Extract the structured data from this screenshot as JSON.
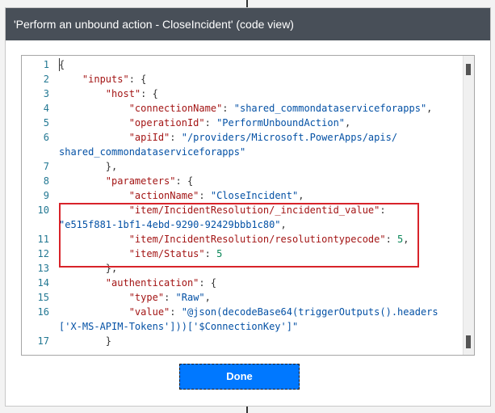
{
  "dialog": {
    "title": "'Perform an unbound action - CloseIncident' (code view)",
    "done_label": "Done"
  },
  "editor": {
    "line_numbers": [
      "1",
      "2",
      "3",
      "4",
      "5",
      "6",
      "",
      "7",
      "8",
      "9",
      "10",
      "",
      "11",
      "12",
      "13",
      "14",
      "15",
      "16",
      "",
      "17"
    ],
    "lines": [
      [
        {
          "t": "{",
          "c": "p"
        }
      ],
      [
        {
          "t": "    ",
          "c": "p"
        },
        {
          "t": "\"inputs\"",
          "c": "k"
        },
        {
          "t": ": {",
          "c": "p"
        }
      ],
      [
        {
          "t": "        ",
          "c": "p"
        },
        {
          "t": "\"host\"",
          "c": "k"
        },
        {
          "t": ": {",
          "c": "p"
        }
      ],
      [
        {
          "t": "            ",
          "c": "p"
        },
        {
          "t": "\"connectionName\"",
          "c": "k"
        },
        {
          "t": ": ",
          "c": "p"
        },
        {
          "t": "\"shared_commondataserviceforapps\"",
          "c": "s"
        },
        {
          "t": ",",
          "c": "p"
        }
      ],
      [
        {
          "t": "            ",
          "c": "p"
        },
        {
          "t": "\"operationId\"",
          "c": "k"
        },
        {
          "t": ": ",
          "c": "p"
        },
        {
          "t": "\"PerformUnboundAction\"",
          "c": "s"
        },
        {
          "t": ",",
          "c": "p"
        }
      ],
      [
        {
          "t": "            ",
          "c": "p"
        },
        {
          "t": "\"apiId\"",
          "c": "k"
        },
        {
          "t": ": ",
          "c": "p"
        },
        {
          "t": "\"/providers/Microsoft.PowerApps/apis/",
          "c": "s"
        }
      ],
      [
        {
          "t": "shared_commondataserviceforapps\"",
          "c": "s"
        }
      ],
      [
        {
          "t": "        },",
          "c": "p"
        }
      ],
      [
        {
          "t": "        ",
          "c": "p"
        },
        {
          "t": "\"parameters\"",
          "c": "k"
        },
        {
          "t": ": {",
          "c": "p"
        }
      ],
      [
        {
          "t": "            ",
          "c": "p"
        },
        {
          "t": "\"actionName\"",
          "c": "k"
        },
        {
          "t": ": ",
          "c": "p"
        },
        {
          "t": "\"CloseIncident\"",
          "c": "s"
        },
        {
          "t": ",",
          "c": "p"
        }
      ],
      [
        {
          "t": "            ",
          "c": "p"
        },
        {
          "t": "\"item/IncidentResolution/_incidentid_value\"",
          "c": "k"
        },
        {
          "t": ":",
          "c": "p"
        }
      ],
      [
        {
          "t": "\"e515f881-1bf1-4ebd-9290-92429bbb1c80\"",
          "c": "s"
        },
        {
          "t": ",",
          "c": "p"
        }
      ],
      [
        {
          "t": "            ",
          "c": "p"
        },
        {
          "t": "\"item/IncidentResolution/resolutiontypecode\"",
          "c": "k"
        },
        {
          "t": ": ",
          "c": "p"
        },
        {
          "t": "5",
          "c": "n"
        },
        {
          "t": ",",
          "c": "p"
        }
      ],
      [
        {
          "t": "            ",
          "c": "p"
        },
        {
          "t": "\"item/Status\"",
          "c": "k"
        },
        {
          "t": ": ",
          "c": "p"
        },
        {
          "t": "5",
          "c": "n"
        }
      ],
      [
        {
          "t": "        },",
          "c": "p"
        }
      ],
      [
        {
          "t": "        ",
          "c": "p"
        },
        {
          "t": "\"authentication\"",
          "c": "k"
        },
        {
          "t": ": {",
          "c": "p"
        }
      ],
      [
        {
          "t": "            ",
          "c": "p"
        },
        {
          "t": "\"type\"",
          "c": "k"
        },
        {
          "t": ": ",
          "c": "p"
        },
        {
          "t": "\"Raw\"",
          "c": "s"
        },
        {
          "t": ",",
          "c": "p"
        }
      ],
      [
        {
          "t": "            ",
          "c": "p"
        },
        {
          "t": "\"value\"",
          "c": "k"
        },
        {
          "t": ": ",
          "c": "p"
        },
        {
          "t": "\"@json(decodeBase64(triggerOutputs().headers",
          "c": "s"
        }
      ],
      [
        {
          "t": "['X-MS-APIM-Tokens']))['$ConnectionKey']\"",
          "c": "s"
        }
      ],
      [
        {
          "t": "        }",
          "c": "p"
        }
      ]
    ]
  }
}
